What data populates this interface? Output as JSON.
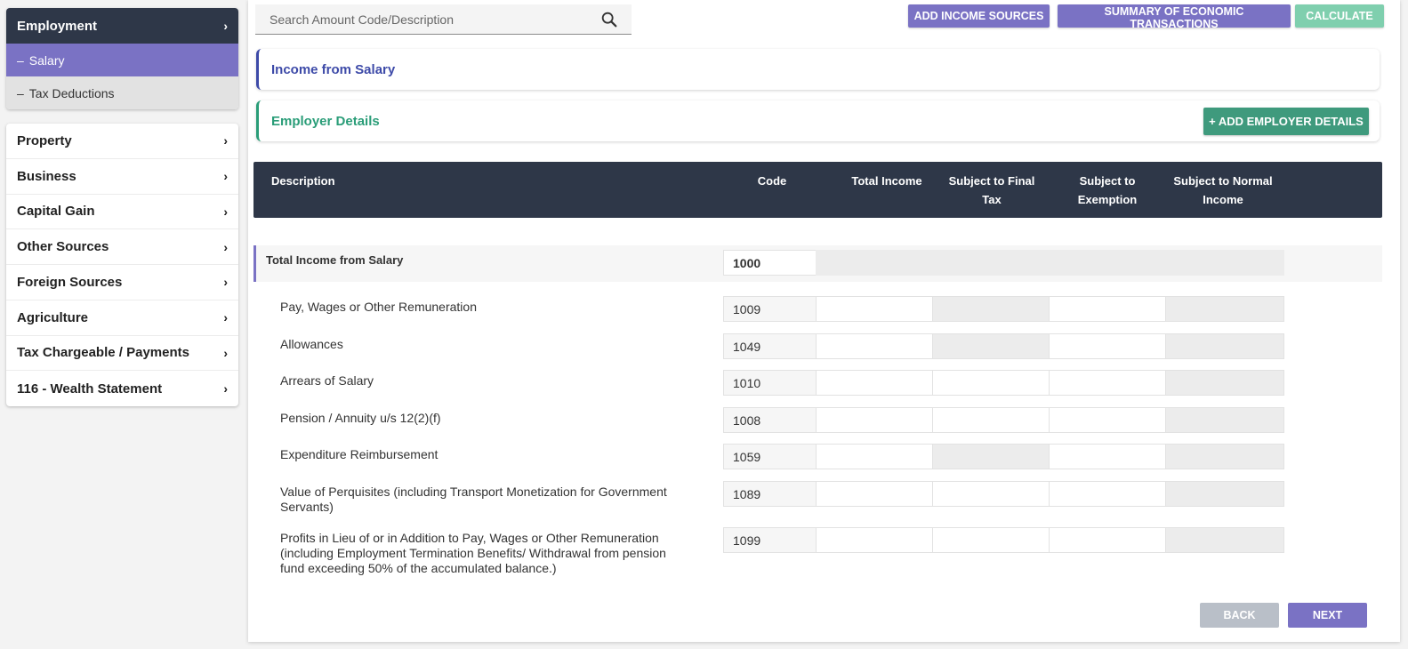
{
  "sidebar": {
    "employment": {
      "label": "Employment",
      "subitems": [
        {
          "label": "Salary",
          "active": true
        },
        {
          "label": "Tax Deductions",
          "active": false
        }
      ]
    },
    "items": [
      {
        "label": "Property"
      },
      {
        "label": "Business"
      },
      {
        "label": "Capital Gain"
      },
      {
        "label": "Other Sources"
      },
      {
        "label": "Foreign Sources"
      },
      {
        "label": "Agriculture"
      },
      {
        "label": "Tax Chargeable / Payments"
      },
      {
        "label": "116 - Wealth Statement"
      }
    ]
  },
  "search": {
    "placeholder": "Search Amount Code/Description",
    "value": ""
  },
  "toolbar": {
    "add_income_sources": "ADD INCOME SOURCES",
    "summary": "SUMMARY OF ECONOMIC TRANSACTIONS",
    "calculate": "CALCULATE"
  },
  "sections": {
    "income_from_salary": "Income from Salary",
    "employer_details": "Employer Details",
    "add_employer_button": "+ ADD EMPLOYER DETAILS"
  },
  "table": {
    "headers": {
      "description": "Description",
      "code": "Code",
      "total_income": "Total Income",
      "final_tax_line1": "Subject to Final",
      "final_tax_line2": "Tax",
      "exemption_line1": "Subject to",
      "exemption_line2": "Exemption",
      "normal_line1": "Subject to Normal",
      "normal_line2": "Income"
    },
    "total_row": {
      "label": "Total Income from Salary",
      "code": "1000"
    },
    "rows": [
      {
        "description": "Pay, Wages or Other Remuneration",
        "code": "1009",
        "total_income": "",
        "final_tax": "",
        "exemption": "",
        "normal": ""
      },
      {
        "description": "Allowances",
        "code": "1049",
        "total_income": "",
        "final_tax": "",
        "exemption": "",
        "normal": ""
      },
      {
        "description": "Arrears of Salary",
        "code": "1010",
        "total_income": "",
        "final_tax": "",
        "exemption": "",
        "normal": ""
      },
      {
        "description": "Pension / Annuity u/s 12(2)(f)",
        "code": "1008",
        "total_income": "",
        "final_tax": "",
        "exemption": "",
        "normal": ""
      },
      {
        "description": "Expenditure Reimbursement",
        "code": "1059",
        "total_income": "",
        "final_tax": "",
        "exemption": "",
        "normal": ""
      },
      {
        "description": "Value of Perquisites (including Transport Monetization for Government Servants)",
        "code": "1089",
        "total_income": "",
        "final_tax": "",
        "exemption": "",
        "normal": ""
      },
      {
        "description": "Profits in Lieu of or in Addition to Pay, Wages or Other Remuneration (including Employment Termination Benefits/ Withdrawal from pension fund exceeding 50% of the accumulated balance.)",
        "code": "1099",
        "total_income": "",
        "final_tax": "",
        "exemption": "",
        "normal": ""
      }
    ]
  },
  "footer": {
    "back": "BACK",
    "next": "NEXT"
  },
  "colors": {
    "navy": "#2e3748",
    "purple": "#7a72c4",
    "green": "#3f9a7d",
    "calculate_disabled": "#7fcfae",
    "back_disabled": "#b9bfc8"
  }
}
